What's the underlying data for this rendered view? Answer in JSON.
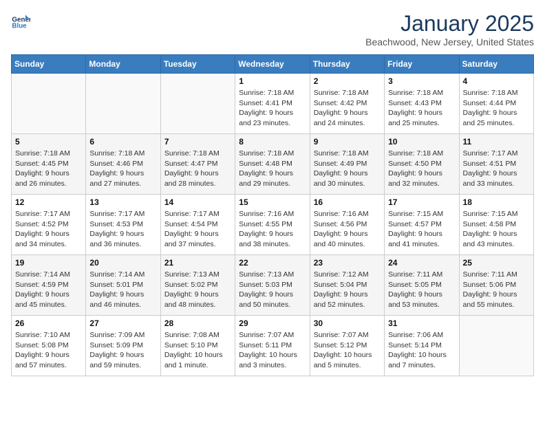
{
  "header": {
    "logo_line1": "General",
    "logo_line2": "Blue",
    "month": "January 2025",
    "location": "Beachwood, New Jersey, United States"
  },
  "weekdays": [
    "Sunday",
    "Monday",
    "Tuesday",
    "Wednesday",
    "Thursday",
    "Friday",
    "Saturday"
  ],
  "weeks": [
    [
      {
        "day": "",
        "sunrise": "",
        "sunset": "",
        "daylight": ""
      },
      {
        "day": "",
        "sunrise": "",
        "sunset": "",
        "daylight": ""
      },
      {
        "day": "",
        "sunrise": "",
        "sunset": "",
        "daylight": ""
      },
      {
        "day": "1",
        "sunrise": "Sunrise: 7:18 AM",
        "sunset": "Sunset: 4:41 PM",
        "daylight": "Daylight: 9 hours and 23 minutes."
      },
      {
        "day": "2",
        "sunrise": "Sunrise: 7:18 AM",
        "sunset": "Sunset: 4:42 PM",
        "daylight": "Daylight: 9 hours and 24 minutes."
      },
      {
        "day": "3",
        "sunrise": "Sunrise: 7:18 AM",
        "sunset": "Sunset: 4:43 PM",
        "daylight": "Daylight: 9 hours and 25 minutes."
      },
      {
        "day": "4",
        "sunrise": "Sunrise: 7:18 AM",
        "sunset": "Sunset: 4:44 PM",
        "daylight": "Daylight: 9 hours and 25 minutes."
      }
    ],
    [
      {
        "day": "5",
        "sunrise": "Sunrise: 7:18 AM",
        "sunset": "Sunset: 4:45 PM",
        "daylight": "Daylight: 9 hours and 26 minutes."
      },
      {
        "day": "6",
        "sunrise": "Sunrise: 7:18 AM",
        "sunset": "Sunset: 4:46 PM",
        "daylight": "Daylight: 9 hours and 27 minutes."
      },
      {
        "day": "7",
        "sunrise": "Sunrise: 7:18 AM",
        "sunset": "Sunset: 4:47 PM",
        "daylight": "Daylight: 9 hours and 28 minutes."
      },
      {
        "day": "8",
        "sunrise": "Sunrise: 7:18 AM",
        "sunset": "Sunset: 4:48 PM",
        "daylight": "Daylight: 9 hours and 29 minutes."
      },
      {
        "day": "9",
        "sunrise": "Sunrise: 7:18 AM",
        "sunset": "Sunset: 4:49 PM",
        "daylight": "Daylight: 9 hours and 30 minutes."
      },
      {
        "day": "10",
        "sunrise": "Sunrise: 7:18 AM",
        "sunset": "Sunset: 4:50 PM",
        "daylight": "Daylight: 9 hours and 32 minutes."
      },
      {
        "day": "11",
        "sunrise": "Sunrise: 7:17 AM",
        "sunset": "Sunset: 4:51 PM",
        "daylight": "Daylight: 9 hours and 33 minutes."
      }
    ],
    [
      {
        "day": "12",
        "sunrise": "Sunrise: 7:17 AM",
        "sunset": "Sunset: 4:52 PM",
        "daylight": "Daylight: 9 hours and 34 minutes."
      },
      {
        "day": "13",
        "sunrise": "Sunrise: 7:17 AM",
        "sunset": "Sunset: 4:53 PM",
        "daylight": "Daylight: 9 hours and 36 minutes."
      },
      {
        "day": "14",
        "sunrise": "Sunrise: 7:17 AM",
        "sunset": "Sunset: 4:54 PM",
        "daylight": "Daylight: 9 hours and 37 minutes."
      },
      {
        "day": "15",
        "sunrise": "Sunrise: 7:16 AM",
        "sunset": "Sunset: 4:55 PM",
        "daylight": "Daylight: 9 hours and 38 minutes."
      },
      {
        "day": "16",
        "sunrise": "Sunrise: 7:16 AM",
        "sunset": "Sunset: 4:56 PM",
        "daylight": "Daylight: 9 hours and 40 minutes."
      },
      {
        "day": "17",
        "sunrise": "Sunrise: 7:15 AM",
        "sunset": "Sunset: 4:57 PM",
        "daylight": "Daylight: 9 hours and 41 minutes."
      },
      {
        "day": "18",
        "sunrise": "Sunrise: 7:15 AM",
        "sunset": "Sunset: 4:58 PM",
        "daylight": "Daylight: 9 hours and 43 minutes."
      }
    ],
    [
      {
        "day": "19",
        "sunrise": "Sunrise: 7:14 AM",
        "sunset": "Sunset: 4:59 PM",
        "daylight": "Daylight: 9 hours and 45 minutes."
      },
      {
        "day": "20",
        "sunrise": "Sunrise: 7:14 AM",
        "sunset": "Sunset: 5:01 PM",
        "daylight": "Daylight: 9 hours and 46 minutes."
      },
      {
        "day": "21",
        "sunrise": "Sunrise: 7:13 AM",
        "sunset": "Sunset: 5:02 PM",
        "daylight": "Daylight: 9 hours and 48 minutes."
      },
      {
        "day": "22",
        "sunrise": "Sunrise: 7:13 AM",
        "sunset": "Sunset: 5:03 PM",
        "daylight": "Daylight: 9 hours and 50 minutes."
      },
      {
        "day": "23",
        "sunrise": "Sunrise: 7:12 AM",
        "sunset": "Sunset: 5:04 PM",
        "daylight": "Daylight: 9 hours and 52 minutes."
      },
      {
        "day": "24",
        "sunrise": "Sunrise: 7:11 AM",
        "sunset": "Sunset: 5:05 PM",
        "daylight": "Daylight: 9 hours and 53 minutes."
      },
      {
        "day": "25",
        "sunrise": "Sunrise: 7:11 AM",
        "sunset": "Sunset: 5:06 PM",
        "daylight": "Daylight: 9 hours and 55 minutes."
      }
    ],
    [
      {
        "day": "26",
        "sunrise": "Sunrise: 7:10 AM",
        "sunset": "Sunset: 5:08 PM",
        "daylight": "Daylight: 9 hours and 57 minutes."
      },
      {
        "day": "27",
        "sunrise": "Sunrise: 7:09 AM",
        "sunset": "Sunset: 5:09 PM",
        "daylight": "Daylight: 9 hours and 59 minutes."
      },
      {
        "day": "28",
        "sunrise": "Sunrise: 7:08 AM",
        "sunset": "Sunset: 5:10 PM",
        "daylight": "Daylight: 10 hours and 1 minute."
      },
      {
        "day": "29",
        "sunrise": "Sunrise: 7:07 AM",
        "sunset": "Sunset: 5:11 PM",
        "daylight": "Daylight: 10 hours and 3 minutes."
      },
      {
        "day": "30",
        "sunrise": "Sunrise: 7:07 AM",
        "sunset": "Sunset: 5:12 PM",
        "daylight": "Daylight: 10 hours and 5 minutes."
      },
      {
        "day": "31",
        "sunrise": "Sunrise: 7:06 AM",
        "sunset": "Sunset: 5:14 PM",
        "daylight": "Daylight: 10 hours and 7 minutes."
      },
      {
        "day": "",
        "sunrise": "",
        "sunset": "",
        "daylight": ""
      }
    ]
  ]
}
